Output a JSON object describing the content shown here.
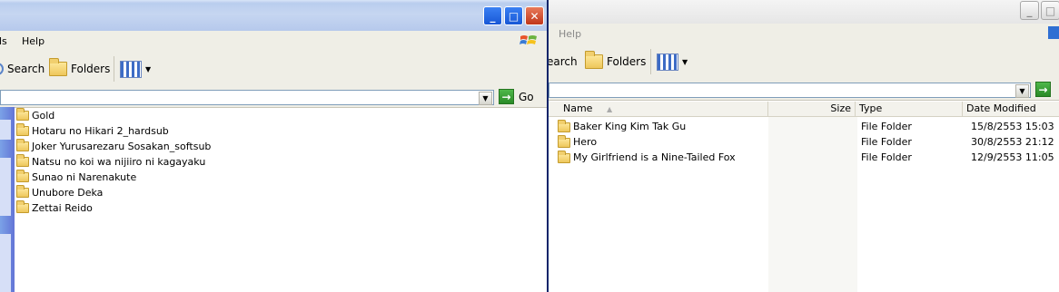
{
  "left_window": {
    "menu": {
      "tools_partial": "ls",
      "help": "Help"
    },
    "toolbar": {
      "search": "Search",
      "folders": "Folders"
    },
    "address": {
      "go": "Go"
    },
    "folders": [
      "Gold",
      "Hotaru no Hikari 2_hardsub",
      "Joker Yurusarezaru Sosakan_softsub",
      "Natsu no koi wa nijiiro ni kagayaku",
      "Sunao ni Narenakute",
      "Unubore Deka",
      "Zettai Reido"
    ]
  },
  "right_window": {
    "menu": {
      "help": "Help"
    },
    "toolbar": {
      "search_partial": "earch",
      "folders": "Folders"
    },
    "columns": {
      "name": "Name",
      "size": "Size",
      "type": "Type",
      "date": "Date Modified"
    },
    "rows": [
      {
        "name": "Baker King Kim Tak Gu",
        "type": "File Folder",
        "date": "15/8/2553 15:03"
      },
      {
        "name": "Hero",
        "type": "File Folder",
        "date": "30/8/2553 21:12"
      },
      {
        "name": "My Girlfriend is a Nine-Tailed Fox",
        "type": "File Folder",
        "date": "12/9/2553 11:05"
      }
    ]
  },
  "colors": {
    "title_active": "#0a246a",
    "chrome": "#efeee6",
    "go_green": "#2a8a27"
  }
}
